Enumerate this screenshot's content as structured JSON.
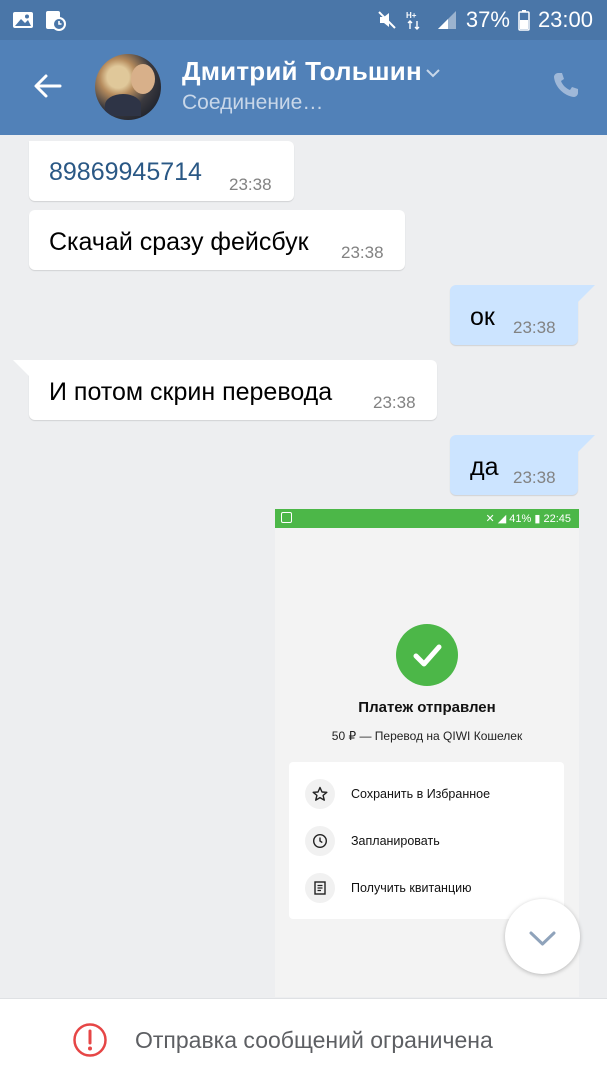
{
  "status_bar": {
    "battery_percent": "37%",
    "time": "23:00",
    "left_icons": [
      "image-icon",
      "clock-notification-icon"
    ],
    "right_icons": [
      "mute-icon",
      "data-arrows-icon",
      "signal-icon",
      "battery-icon"
    ]
  },
  "header": {
    "contact_name": "Дмитрий Тольшин",
    "status": "Соединение…",
    "icons": [
      "back-arrow-icon",
      "chevron-down-icon",
      "phone-icon"
    ]
  },
  "messages": [
    {
      "direction": "in",
      "text": "89869945714",
      "time": "23:38",
      "is_link": true
    },
    {
      "direction": "in",
      "text": "Скачай сразу фейсбук",
      "time": "23:38"
    },
    {
      "direction": "out",
      "text": "ок",
      "time": "23:38"
    },
    {
      "direction": "in",
      "text": "И потом скрин перевода",
      "time": "23:38"
    },
    {
      "direction": "out",
      "text": "да",
      "time": "23:38"
    }
  ],
  "attachment": {
    "status_bar": {
      "battery": "41%",
      "time": "22:45"
    },
    "title": "Платеж отправлен",
    "subtitle": "50 ₽ — Перевод на QIWI Кошелек",
    "options": [
      {
        "label": "Сохранить в Избранное",
        "icon": "star-icon"
      },
      {
        "label": "Запланировать",
        "icon": "clock-icon"
      },
      {
        "label": "Получить квитанцию",
        "icon": "receipt-icon"
      }
    ],
    "accent_color": "#4cb748"
  },
  "bottom_bar": {
    "text": "Отправка сообщений ограничена",
    "icon": "warning-circle-icon",
    "icon_color": "#e64646"
  },
  "colors": {
    "status_bar": "#4a76a8",
    "header": "#5181b8",
    "background": "#edeef0",
    "outgoing_bubble": "#cce4ff",
    "incoming_bubble": "#ffffff"
  }
}
